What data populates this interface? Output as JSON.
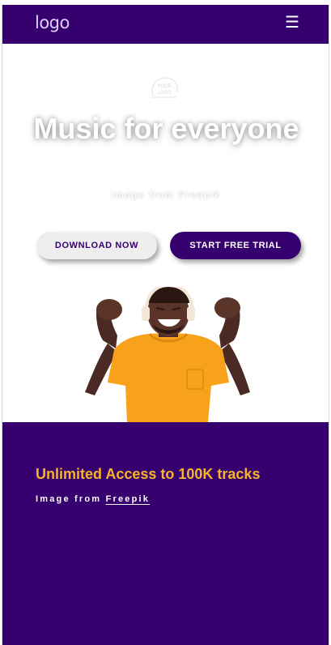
{
  "header": {
    "logo_text": "logo",
    "menu_icon": "hamburger-icon",
    "background_color": "#36006f"
  },
  "hero": {
    "badge_text_line1": "YOUR",
    "badge_text_line2": "LOGO",
    "title": "Music for everyone",
    "credit": "Image from Freepik",
    "buttons": {
      "download_label": "DOWNLOAD NOW",
      "trial_label": "START FREE TRIAL"
    }
  },
  "feature": {
    "title": "Unlimited Access to 100K tracks",
    "credit_prefix": "Image from",
    "credit_link": "Freepik",
    "title_color": "#f7b32b",
    "background_color": "#36006f"
  }
}
